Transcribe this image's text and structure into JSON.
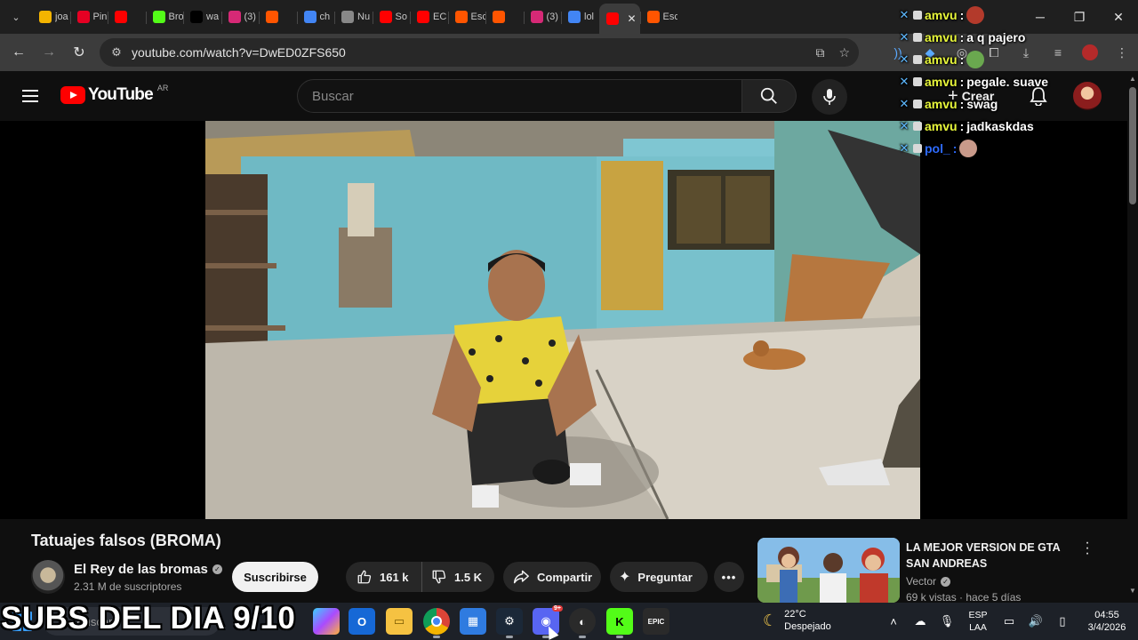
{
  "browser": {
    "tabs": [
      {
        "title": "joa",
        "icon": "google-drive-icon",
        "color": "#f4b400"
      },
      {
        "title": "Pin",
        "icon": "pinterest-icon",
        "color": "#e60023"
      },
      {
        "title": "",
        "icon": "youtube-icon",
        "color": "#ff0000"
      },
      {
        "title": "Bro",
        "icon": "kick-icon",
        "color": "#53fc18"
      },
      {
        "title": "wa",
        "icon": "x-icon",
        "color": "#000000"
      },
      {
        "title": "(3)",
        "icon": "instagram-icon",
        "color": "#d62976"
      },
      {
        "title": "",
        "icon": "soundcloud-icon",
        "color": "#ff5500"
      },
      {
        "title": "ch",
        "icon": "google-icon",
        "color": "#4285f4"
      },
      {
        "title": "Nu",
        "icon": "chatgpt-icon",
        "color": "#888888"
      },
      {
        "title": "So",
        "icon": "youtube-icon",
        "color": "#ff0000"
      },
      {
        "title": "EC",
        "icon": "youtube-icon",
        "color": "#ff0000"
      },
      {
        "title": "Esc",
        "icon": "soundcloud-icon",
        "color": "#ff5500"
      },
      {
        "title": "",
        "icon": "soundcloud-icon",
        "color": "#ff5500"
      },
      {
        "title": "(3)",
        "icon": "instagram-icon",
        "color": "#d62976"
      },
      {
        "title": "lol",
        "icon": "google-icon",
        "color": "#4285f4"
      },
      {
        "title": "",
        "icon": "youtube-icon",
        "color": "#ff0000",
        "active": true
      },
      {
        "title": "Esc",
        "icon": "soundcloud-icon",
        "color": "#ff5500"
      }
    ],
    "url": "youtube.com/watch?v=DwED0ZFS650"
  },
  "youtube": {
    "logo_text": "YouTube",
    "region": "AR",
    "search_placeholder": "Buscar",
    "create_label": "Crear"
  },
  "chat": [
    {
      "user": "amvu",
      "message": "",
      "emote": "#b33a2b"
    },
    {
      "user": "amvu",
      "message": "a q pajero"
    },
    {
      "user": "amvu",
      "message": "",
      "emote": "#6aa84f"
    },
    {
      "user": "amvu",
      "message": "pegale. suave"
    },
    {
      "user": "amvu",
      "message": "swag"
    },
    {
      "user": "amvu",
      "message": "jadkaskdas"
    },
    {
      "user": "pol_",
      "message": "",
      "emote": "#c99a8a",
      "blue": true
    }
  ],
  "video": {
    "title": "Tatuajes falsos (BROMA)",
    "channel": "El Rey de las bromas",
    "subscribers": "2.31 M de suscriptores",
    "subscribe_label": "Suscribirse",
    "likes": "161 k",
    "dislikes": "1.5 K",
    "share_label": "Compartir",
    "ask_label": "Preguntar"
  },
  "recommended": {
    "title": "LA MEJOR VERSION DE GTA SAN ANDREAS",
    "channel": "Vector",
    "meta": "69 k vistas · hace 5 días"
  },
  "taskbar": {
    "search_placeholder": "Buscar",
    "temperature": "22°C",
    "weather": "Despejado",
    "lang_line1": "ESP",
    "lang_line2": "LAA",
    "time": "04:55",
    "date": "3/4/2026",
    "notification_count": "9+"
  },
  "overlay_caption": "SUBS DEL DIA 9/10"
}
